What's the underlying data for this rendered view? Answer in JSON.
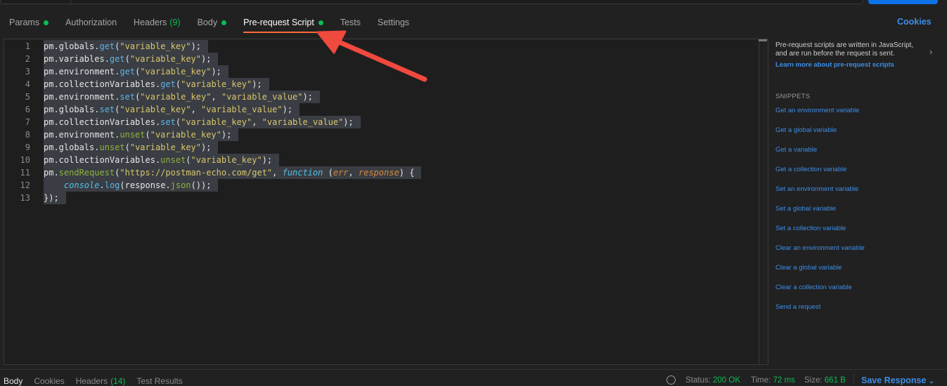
{
  "tabs": [
    {
      "label": "Params",
      "dot": true
    },
    {
      "label": "Authorization"
    },
    {
      "label": "Headers",
      "count": "(9)"
    },
    {
      "label": "Body",
      "dot": true
    },
    {
      "label": "Pre-request Script",
      "dot": true,
      "active": true
    },
    {
      "label": "Tests"
    },
    {
      "label": "Settings"
    }
  ],
  "cookies_label": "Cookies",
  "code_lines": [
    [
      [
        "p",
        "pm.globals."
      ],
      [
        "m",
        "get"
      ],
      [
        "p",
        "("
      ],
      [
        "s",
        "\"variable_key\""
      ],
      [
        "p",
        ");"
      ]
    ],
    [
      [
        "p",
        "pm.variables."
      ],
      [
        "m",
        "get"
      ],
      [
        "p",
        "("
      ],
      [
        "s",
        "\"variable_key\""
      ],
      [
        "p",
        ");"
      ]
    ],
    [
      [
        "p",
        "pm.environment."
      ],
      [
        "m",
        "get"
      ],
      [
        "p",
        "("
      ],
      [
        "s",
        "\"variable_key\""
      ],
      [
        "p",
        ");"
      ]
    ],
    [
      [
        "p",
        "pm.collectionVariables."
      ],
      [
        "m",
        "get"
      ],
      [
        "p",
        "("
      ],
      [
        "s",
        "\"variable_key\""
      ],
      [
        "p",
        ");"
      ]
    ],
    [
      [
        "p",
        "pm.environment."
      ],
      [
        "m",
        "set"
      ],
      [
        "p",
        "("
      ],
      [
        "s",
        "\"variable_key\""
      ],
      [
        "p",
        ", "
      ],
      [
        "s",
        "\"variable_value\""
      ],
      [
        "p",
        ");"
      ]
    ],
    [
      [
        "p",
        "pm.globals."
      ],
      [
        "m",
        "set"
      ],
      [
        "p",
        "("
      ],
      [
        "s",
        "\"variable_key\""
      ],
      [
        "p",
        ", "
      ],
      [
        "s",
        "\"variable_value\""
      ],
      [
        "p",
        ");"
      ]
    ],
    [
      [
        "p",
        "pm.collectionVariables."
      ],
      [
        "m",
        "set"
      ],
      [
        "p",
        "("
      ],
      [
        "s",
        "\"variable_key\""
      ],
      [
        "p",
        ", "
      ],
      [
        "s",
        "\"variable_value\""
      ],
      [
        "p",
        ");"
      ]
    ],
    [
      [
        "p",
        "pm.environment."
      ],
      [
        "u",
        "unset"
      ],
      [
        "p",
        "("
      ],
      [
        "s",
        "\"variable_key\""
      ],
      [
        "p",
        ");"
      ]
    ],
    [
      [
        "p",
        "pm.globals."
      ],
      [
        "u",
        "unset"
      ],
      [
        "p",
        "("
      ],
      [
        "s",
        "\"variable_key\""
      ],
      [
        "p",
        ");"
      ]
    ],
    [
      [
        "p",
        "pm.collectionVariables."
      ],
      [
        "u",
        "unset"
      ],
      [
        "p",
        "("
      ],
      [
        "s",
        "\"variable_key\""
      ],
      [
        "p",
        ");"
      ]
    ],
    [
      [
        "p",
        "pm."
      ],
      [
        "u",
        "sendRequest"
      ],
      [
        "p",
        "("
      ],
      [
        "s",
        "\"https://postman-echo.com/get\""
      ],
      [
        "p",
        ", "
      ],
      [
        "k",
        "function"
      ],
      [
        "p",
        " ("
      ],
      [
        "pa",
        "err"
      ],
      [
        "p",
        ", "
      ],
      [
        "pa",
        "response"
      ],
      [
        "p",
        ") {"
      ]
    ],
    [
      [
        "p",
        "    "
      ],
      [
        "k",
        "console"
      ],
      [
        "p",
        "."
      ],
      [
        "m",
        "log"
      ],
      [
        "p",
        "(response."
      ],
      [
        "u",
        "json"
      ],
      [
        "p",
        "());"
      ]
    ],
    [
      [
        "p",
        "});"
      ]
    ]
  ],
  "info": {
    "text": "Pre-request scripts are written in JavaScript, and are run before the request is sent.",
    "link": "Learn more about pre-request scripts"
  },
  "snippets_heading": "SNIPPETS",
  "snippets": [
    "Get an environment variable",
    "Get a global variable",
    "Get a variable",
    "Get a collection variable",
    "Set an environment variable",
    "Set a global variable",
    "Set a collection variable",
    "Clear an environment variable",
    "Clear a global variable",
    "Clear a collection variable",
    "Send a request"
  ],
  "response": {
    "tabs": [
      {
        "label": "Body",
        "active": true
      },
      {
        "label": "Cookies"
      },
      {
        "label": "Headers",
        "count": "(14)"
      },
      {
        "label": "Test Results"
      }
    ],
    "status_label": "Status:",
    "status": "200 OK",
    "time_label": "Time:",
    "time": "72 ms",
    "size_label": "Size:",
    "size": "661 B",
    "save": "Save Response"
  },
  "colors": {
    "accent": "#ff6c37",
    "link": "#3d8ee8",
    "ok": "#0cbb52",
    "annotation_arrow": "#f0493e"
  }
}
